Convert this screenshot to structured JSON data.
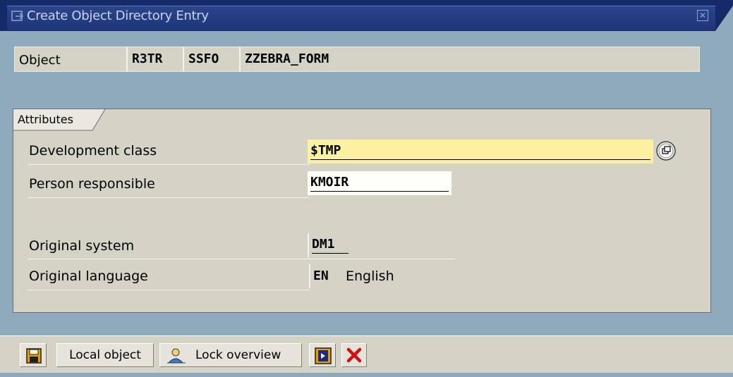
{
  "window": {
    "title": "Create Object Directory Entry"
  },
  "object": {
    "label": "Object",
    "pgmid": "R3TR",
    "type": "SSFO",
    "name": "ZZEBRA_FORM"
  },
  "attributes": {
    "group_title": "Attributes",
    "development_class": {
      "label": "Development class",
      "value": "$TMP"
    },
    "person_responsible": {
      "label": "Person responsible",
      "value": "KMOIR"
    },
    "original_system": {
      "label": "Original system",
      "value": "DM1"
    },
    "original_language": {
      "label": "Original language",
      "code": "EN",
      "text": "English"
    }
  },
  "toolbar": {
    "save_icon": "save-disk-icon",
    "local_object_label": "Local object",
    "lock_overview_label": "Lock overview",
    "lock_overview_icon": "person-lock-icon",
    "transport_icon": "transport-icon",
    "cancel_icon": "cancel-x-icon"
  },
  "colors": {
    "title_bar": "#152868",
    "background": "#8faabd",
    "panel": "#d5d2c6",
    "required_field": "#fcf0a1",
    "cancel_red": "#d01010"
  }
}
